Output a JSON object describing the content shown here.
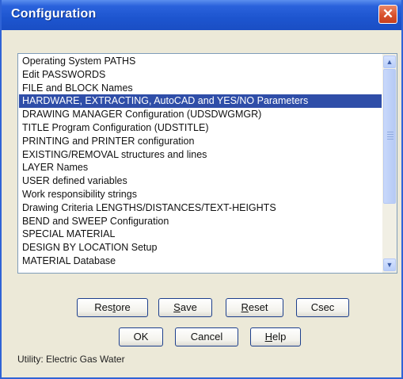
{
  "window": {
    "title": "Configuration",
    "close_glyph": "✕"
  },
  "list": {
    "selected_index": 3,
    "items": [
      "Operating System PATHS",
      "Edit PASSWORDS",
      "FILE and BLOCK Names",
      "HARDWARE, EXTRACTING, AutoCAD and YES/NO Parameters",
      "DRAWING MANAGER Configuration (UDSDWGMGR)",
      "TITLE Program Configuration (UDSTITLE)",
      "PRINTING and PRINTER configuration",
      "EXISTING/REMOVAL structures and lines",
      "LAYER Names",
      "USER defined variables",
      "Work responsibility strings",
      "Drawing Criteria LENGTHS/DISTANCES/TEXT-HEIGHTS",
      "BEND and SWEEP Configuration",
      "SPECIAL MATERIAL",
      "DESIGN BY LOCATION Setup",
      "MATERIAL Database"
    ]
  },
  "scrollbar": {
    "up_glyph": "▲",
    "down_glyph": "▼"
  },
  "buttons": {
    "restore": {
      "pre": "Res",
      "mnemonic": "t",
      "post": "ore"
    },
    "save": {
      "pre": "",
      "mnemonic": "S",
      "post": "ave"
    },
    "reset": {
      "pre": "",
      "mnemonic": "R",
      "post": "eset"
    },
    "csec": {
      "label": "Csec"
    },
    "ok": {
      "label": "OK"
    },
    "cancel": {
      "label": "Cancel"
    },
    "help": {
      "pre": "",
      "mnemonic": "H",
      "post": "elp"
    }
  },
  "status": {
    "text": "Utility:  Electric Gas Water"
  },
  "colors": {
    "titlebar": "#1d55cf",
    "selection": "#2f4ea8",
    "close_button": "#d9512d"
  }
}
